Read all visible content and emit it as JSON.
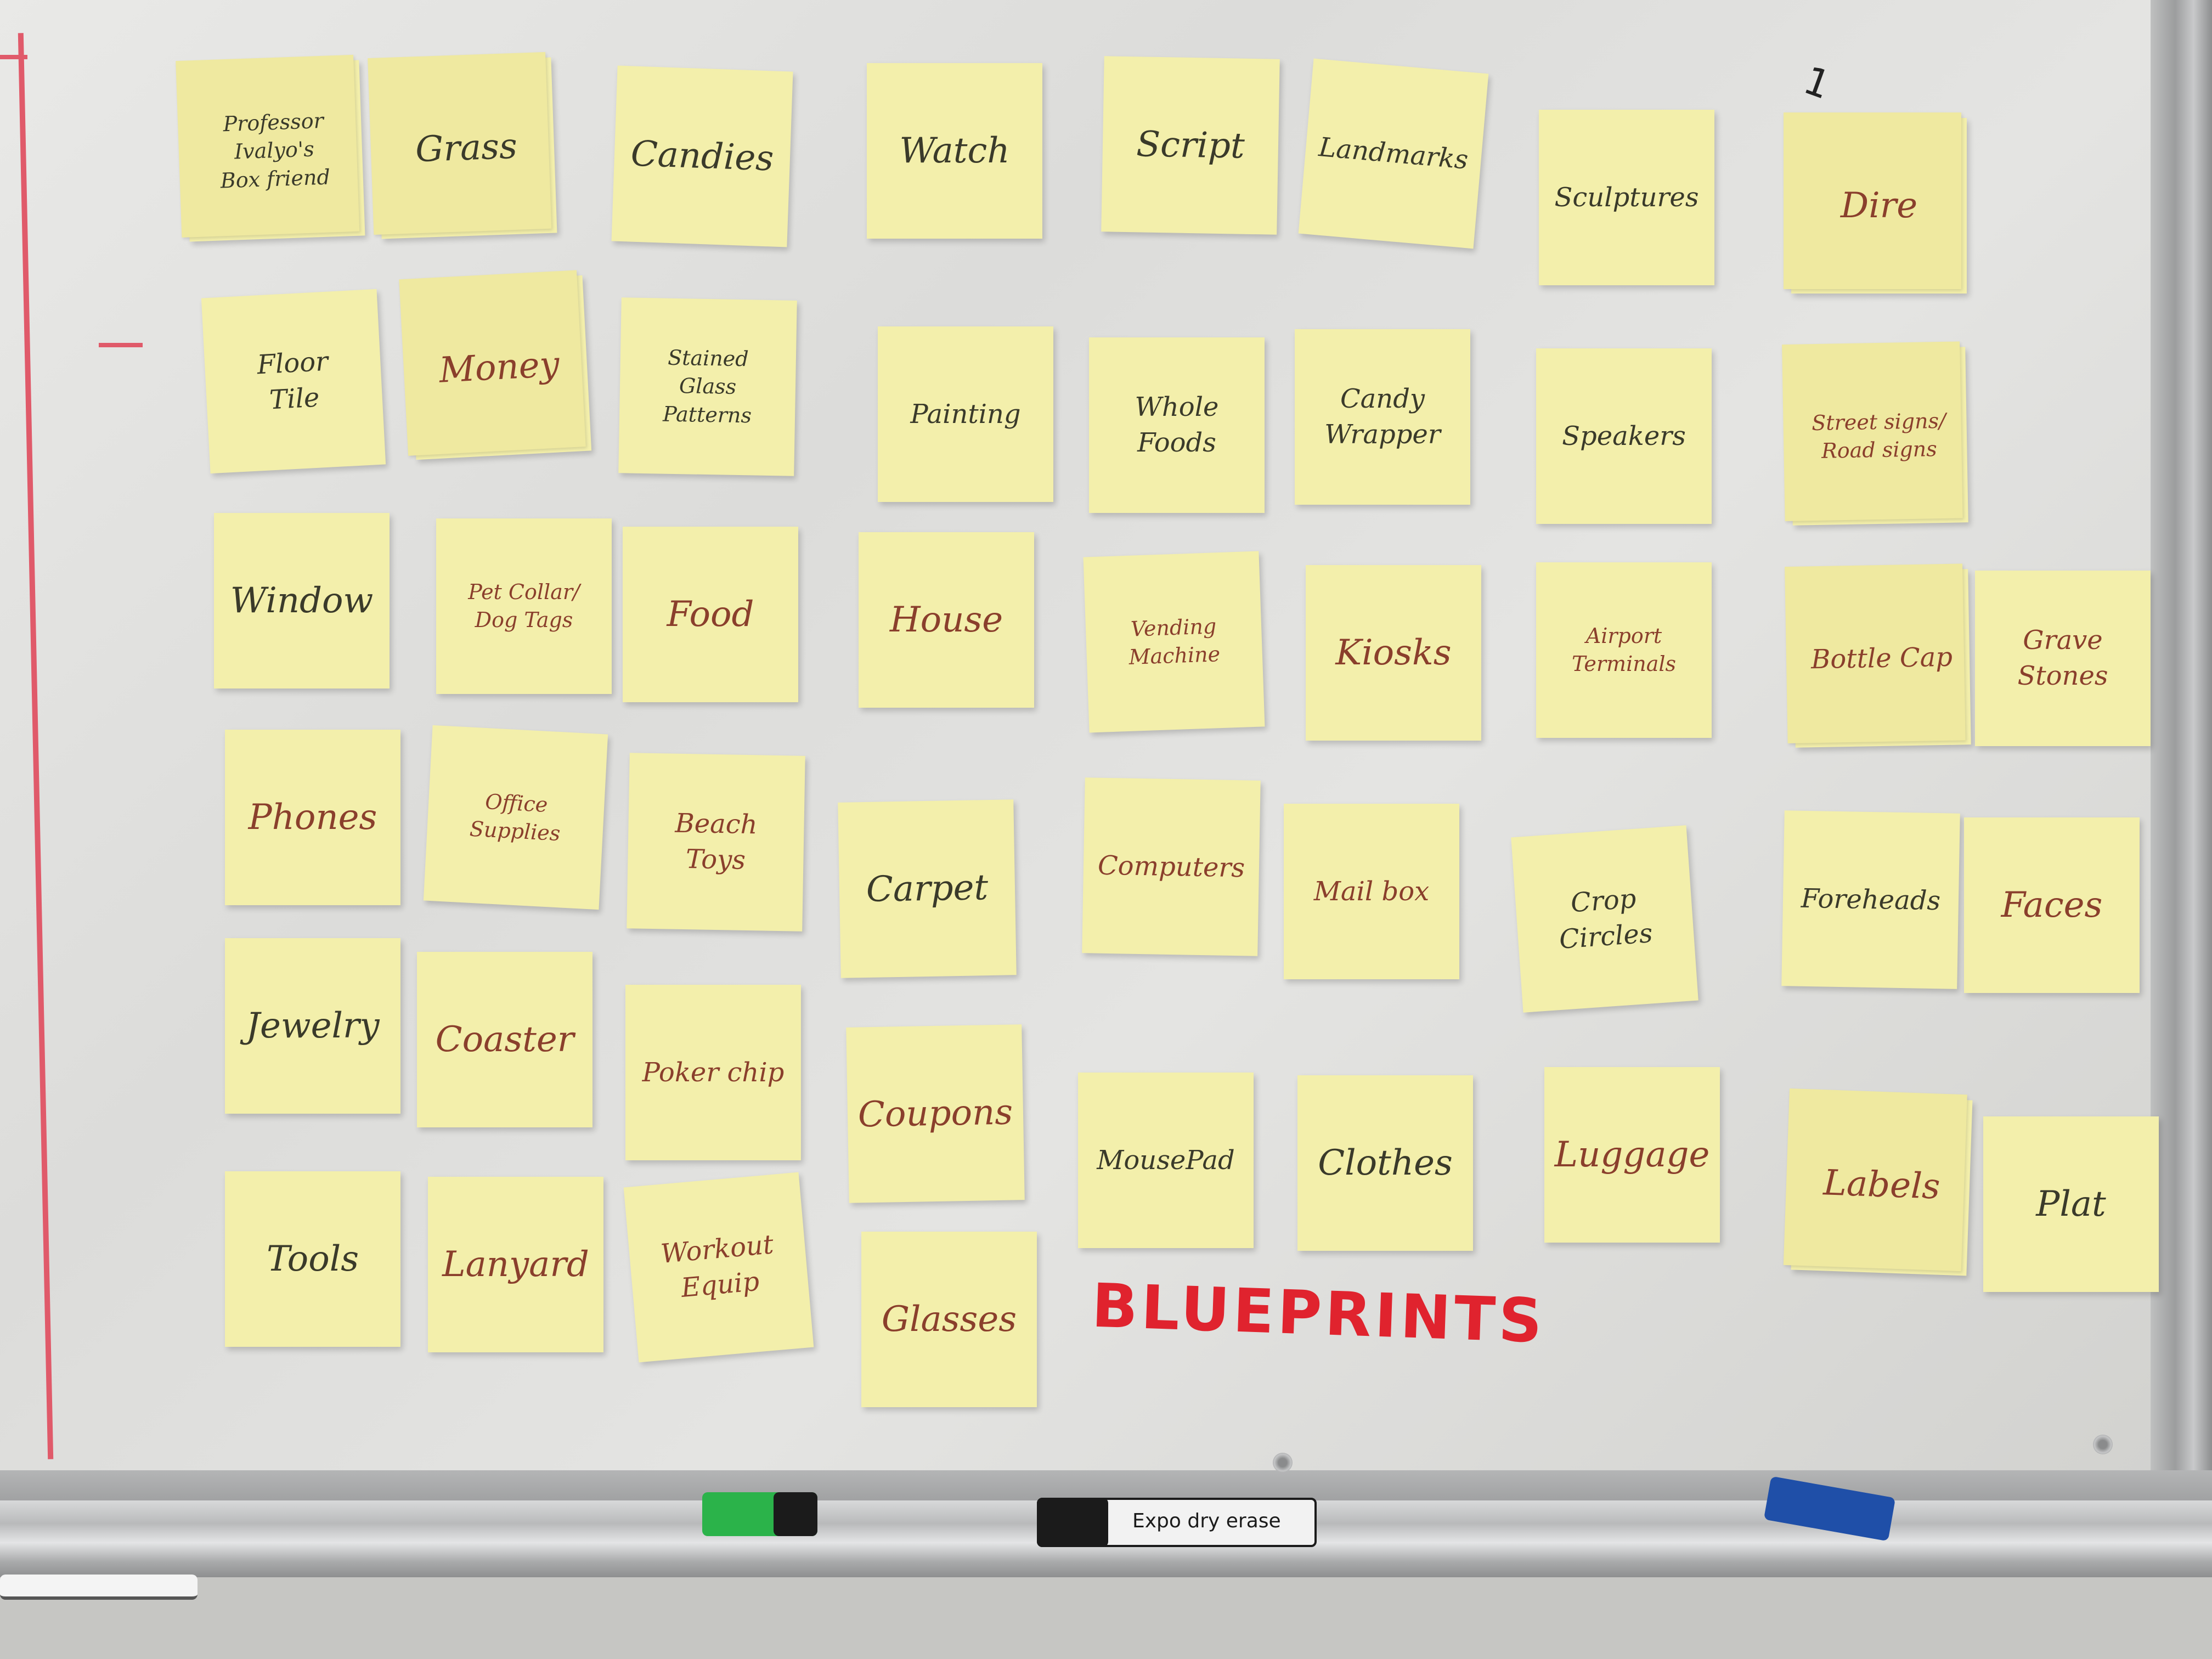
{
  "notes": [
    {
      "text": "Professor\nIvalyo's\nBox friend",
      "ink": "black"
    },
    {
      "text": "Grass",
      "ink": "black"
    },
    {
      "text": "Candies",
      "ink": "black"
    },
    {
      "text": "Watch",
      "ink": "black"
    },
    {
      "text": "Script",
      "ink": "black"
    },
    {
      "text": "Landmarks",
      "ink": "black"
    },
    {
      "text": "Sculptures",
      "ink": "black"
    },
    {
      "text": "Dire",
      "ink": "red"
    },
    {
      "text": "Floor\nTile",
      "ink": "black"
    },
    {
      "text": "Money",
      "ink": "red"
    },
    {
      "text": "Stained\nGlass\nPatterns",
      "ink": "black"
    },
    {
      "text": "Painting",
      "ink": "black"
    },
    {
      "text": "Whole\nFoods",
      "ink": "black"
    },
    {
      "text": "Candy\nWrapper",
      "ink": "black"
    },
    {
      "text": "Speakers",
      "ink": "black"
    },
    {
      "text": "Street signs/\nRoad signs",
      "ink": "red"
    },
    {
      "text": "Window",
      "ink": "black"
    },
    {
      "text": "Pet Collar/\nDog Tags",
      "ink": "red"
    },
    {
      "text": "Food",
      "ink": "red"
    },
    {
      "text": "House",
      "ink": "red"
    },
    {
      "text": "Vending\nMachine",
      "ink": "red"
    },
    {
      "text": "Kiosks",
      "ink": "red"
    },
    {
      "text": "Airport\nTerminals",
      "ink": "red"
    },
    {
      "text": "Bottle Cap",
      "ink": "red"
    },
    {
      "text": "Grave Stones",
      "ink": "red"
    },
    {
      "text": "Phones",
      "ink": "red"
    },
    {
      "text": "Office\nSupplies",
      "ink": "red"
    },
    {
      "text": "Beach\nToys",
      "ink": "red"
    },
    {
      "text": "Carpet",
      "ink": "black"
    },
    {
      "text": "Computers",
      "ink": "red"
    },
    {
      "text": "Mail box",
      "ink": "red"
    },
    {
      "text": "Crop\nCircles",
      "ink": "black"
    },
    {
      "text": "Foreheads",
      "ink": "black"
    },
    {
      "text": "Faces",
      "ink": "red"
    },
    {
      "text": "Jewelry",
      "ink": "black"
    },
    {
      "text": "Coaster",
      "ink": "red"
    },
    {
      "text": "Poker chip",
      "ink": "red"
    },
    {
      "text": "Coupons",
      "ink": "red"
    },
    {
      "text": "MousePad",
      "ink": "black"
    },
    {
      "text": "Clothes",
      "ink": "black"
    },
    {
      "text": "Luggage",
      "ink": "red"
    },
    {
      "text": "Labels",
      "ink": "red"
    },
    {
      "text": "Plat",
      "ink": "black"
    },
    {
      "text": "Tools",
      "ink": "black"
    },
    {
      "text": "Lanyard",
      "ink": "red"
    },
    {
      "text": "Workout\nEquip",
      "ink": "red"
    },
    {
      "text": "Glasses",
      "ink": "red"
    }
  ],
  "board_heading": "BLUEPRINTS",
  "board_mark": "1",
  "marker_label": "Expo dry erase",
  "colors": {
    "note": "#f3efab",
    "heading_ink": "#e0232e",
    "marker_green": "#2bb34a",
    "marker_blue": "#1f4fa8",
    "marker_black": "#1b1b1b"
  }
}
